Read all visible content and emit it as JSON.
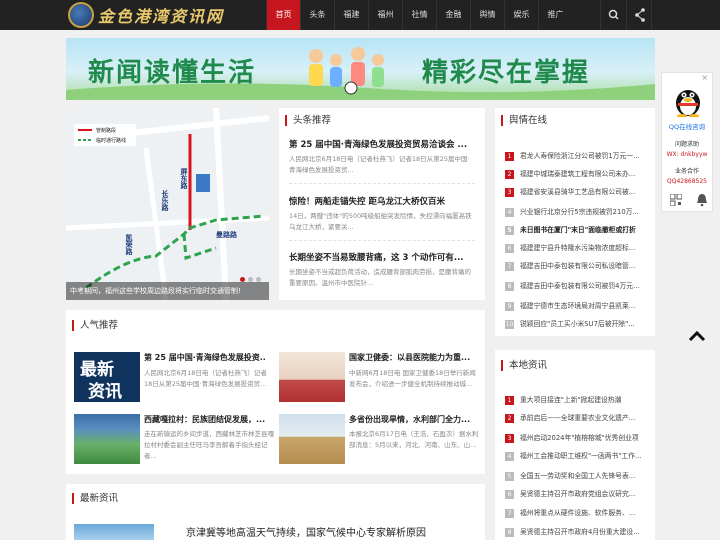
{
  "nav": {
    "items": [
      "首页",
      "头条",
      "福建",
      "福州",
      "社情",
      "金融",
      "舆情",
      "娱乐",
      "推广"
    ]
  },
  "logo": {
    "text": "金色港湾资讯网"
  },
  "banner": {
    "left": "新闻读懂生活",
    "right": "精彩尽在掌握"
  },
  "map": {
    "legend": [
      "管制路段",
      "临时通行路线"
    ],
    "road_labels": [
      "屏东路",
      "长乐路",
      "凯荣路",
      "曼路路"
    ],
    "caption": "中考期间，福州这些学校周边路段将实行临时交通管制!"
  },
  "headlines": {
    "title": "头条推荐",
    "items": [
      {
        "title": "第 25 届中国·青海绿色发展投资贸易洽谈会 ...",
        "desc": "人民网北京6月18日电（记者杜燕飞）记者18日从第25届中国·青海绿色发展投资贸..."
      },
      {
        "title": "惊险！两船走锚失控 距乌龙江大桥仅百米",
        "desc": "14日，两艘\"违体\"的500吨级船舶突发险情，失控漂向福厦高铁乌龙江大桥，紧要关..."
      },
      {
        "title": "长期坐姿不当易致腰背痛，这 3 个动作可有...",
        "desc": "长期坐姿不当或超负荷活动，造成腰背部肌肉劳损，是腰背痛的重要原因。温州市中医院针..."
      }
    ]
  },
  "sentiment": {
    "title": "舆情在线",
    "items": [
      {
        "num": "1",
        "text": "君龙人寿保险浙江分公司被罚1万元一..."
      },
      {
        "num": "2",
        "text": "福建中城瑞泰建筑工程有限公司未办..."
      },
      {
        "num": "3",
        "text": "福建省安溪县骑华工艺品有限公司被..."
      },
      {
        "num": "4",
        "text": "兴业银行北京分行5宗违规被罚210万..."
      },
      {
        "num": "5",
        "text": "未日图书在厦门\"末日\"面临撤柜或打折"
      },
      {
        "num": "6",
        "text": "福建建宁县升特隆水污染物浓度超标..."
      },
      {
        "num": "7",
        "text": "福建吉田中泰包装有限公司私设暗管..."
      },
      {
        "num": "8",
        "text": "福建吉田中泰包装有限公司被罚4万元..."
      },
      {
        "num": "9",
        "text": "福建宁德市生态环境局对周宁县凯莱..."
      },
      {
        "num": "10",
        "text": "锐颖回应\"员工买小米SU7后被开除\"..."
      }
    ]
  },
  "popular": {
    "title": "人气推荐",
    "thumb_text": [
      "最新",
      "资讯"
    ],
    "items": [
      {
        "title": "第 25 届中国·青海绿色发展投资...",
        "desc": "人民网北京6月18日电（记者杜燕飞）记者18日从第25届中国·青海绿色发展投资贸..."
      },
      {
        "title": "国家卫健委：以县医院能力为重...",
        "desc": "中新网6月18日电 国家卫健委18日举行新闻发布会，介绍进一步健全机制持续推动城..."
      },
      {
        "title": "西藏嘎拉村：民族团结促发展，...",
        "desc": "走在新镇运的乡间步道，西藏林芝市林芝县嘎拉村村委会副主任旺马李吾解着手指头经记者..."
      },
      {
        "title": "多省份出现旱情，水利部门全力...",
        "desc": "本报北京6月17日电（王浩、石盈次）据水利部消息：5月以来，河北、河南、山东、山..."
      }
    ]
  },
  "local": {
    "title": "本地资讯",
    "items": [
      {
        "num": "1",
        "text": "重大项目接连\"上新\"掀起建设热潮"
      },
      {
        "num": "2",
        "text": "承前启后——全球重要农业文化遗产..."
      },
      {
        "num": "3",
        "text": "福州启动2024年\"植榕榕城\"优秀创业项"
      },
      {
        "num": "4",
        "text": "福州工会推动职工维权\"一函两书\"工作..."
      },
      {
        "num": "5",
        "text": "全国五一劳动奖和全国工人先锋号表..."
      },
      {
        "num": "6",
        "text": "吴贤德主持召开市政府党组会议研究..."
      },
      {
        "num": "7",
        "text": "福州将重点从硬件设施、软件服务、..."
      },
      {
        "num": "8",
        "text": "吴贤德主持召开市政府4月份重大建设..."
      }
    ]
  },
  "latest": {
    "title": "最新资讯",
    "items": [
      {
        "title": "京津冀等地高温天气持续，国家气候中心专家解析原因"
      }
    ]
  },
  "qq": {
    "label": "QQ在线咨询",
    "question_label": "问题求助",
    "wx": "WX: dnkbyyw",
    "business_label": "业务合作",
    "qq_number": "QQ42868525"
  },
  "colors": {
    "accent": "#c8161e",
    "topbar": "#222222",
    "banner_text": "#1f8a4c"
  }
}
